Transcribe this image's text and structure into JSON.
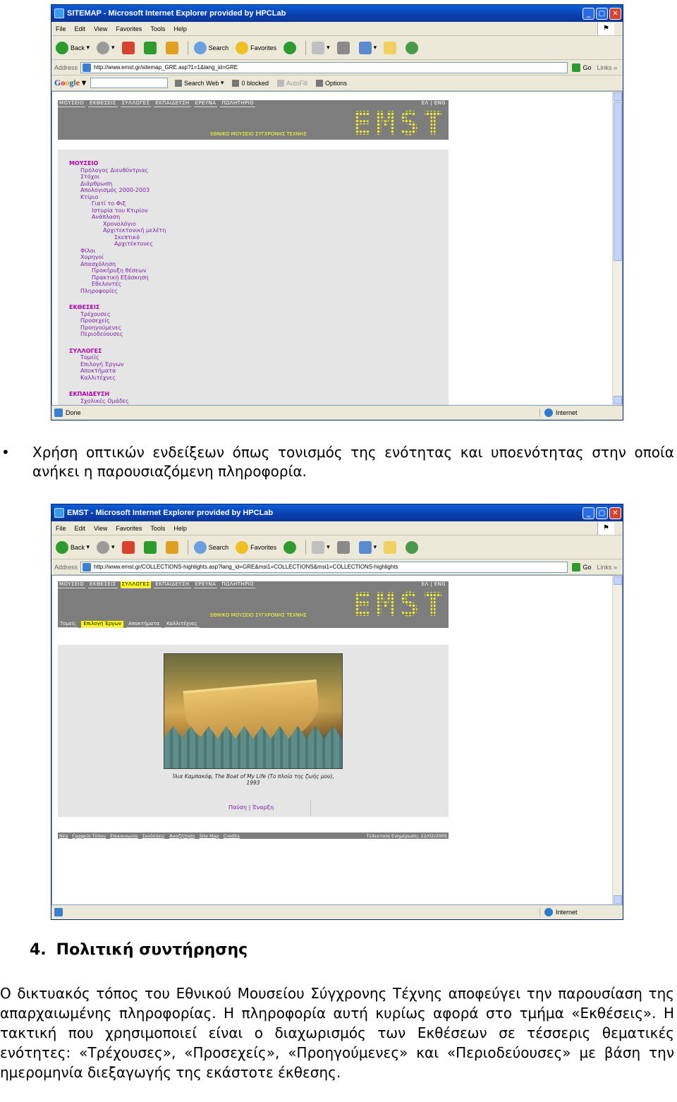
{
  "screenshot1": {
    "window_title": "SITEMAP - Microsoft Internet Explorer provided by HPCLab",
    "menu": [
      "File",
      "Edit",
      "View",
      "Favorites",
      "Tools",
      "Help"
    ],
    "toolbar": {
      "back": "Back",
      "search": "Search",
      "favorites": "Favorites"
    },
    "address_label": "Address",
    "address_url": "http://www.emst.gr/sitemap_GRE.asp?1=1&lang_id=GRE",
    "go": "Go",
    "links": "Links",
    "google": {
      "logo": [
        "G",
        "o",
        "o",
        "g",
        "l",
        "e"
      ],
      "search_web": "Search Web",
      "blocked": "0 blocked",
      "autofill": "AutoFill",
      "options": "Options"
    },
    "site_nav": [
      "ΜΟΥΣΕΙΟ",
      "ΕΚΘΕΣΕΙΣ",
      "ΣΥΛΛΟΓΕΣ",
      "ΕΚΠΑΙΔΕΥΣΗ",
      "ΕΡΕΥΝΑ",
      "ΠΩΛΗΤΗΡΙΟ"
    ],
    "lang": "ΕΛ | ENG",
    "museum_name": "ΕΘΝΙΚΟ ΜΟΥΣΕΙΟ ΣΥΓΧΡΟΝΗΣ ΤΕΧΝΗΣ",
    "logo": "EMST",
    "sitemap": [
      {
        "text": "ΜΟΥΣΕΙΟ",
        "level": 0
      },
      {
        "text": "Πρόλογος Διευθύντριας",
        "level": 1
      },
      {
        "text": "Στόχοι",
        "level": 1
      },
      {
        "text": "Διάρθρωση",
        "level": 1
      },
      {
        "text": "Απολογισμός 2000-2003",
        "level": 1
      },
      {
        "text": "Κτίριο",
        "level": 1
      },
      {
        "text": "Γιατί το Φιξ",
        "level": 2
      },
      {
        "text": "Ιστορία του Κτιρίου",
        "level": 2
      },
      {
        "text": "Ανάπλαση",
        "level": 2
      },
      {
        "text": "Χρονολόγιο",
        "level": 3
      },
      {
        "text": "Αρχιτεκτονική μελέτη",
        "level": 3
      },
      {
        "text": "Σκεπτικό",
        "level": 4
      },
      {
        "text": "Αρχιτέκτονες",
        "level": 4
      },
      {
        "text": "Φίλοι",
        "level": 1
      },
      {
        "text": "Χορηγοί",
        "level": 1
      },
      {
        "text": "Απασχόληση",
        "level": 1
      },
      {
        "text": "Προκήρυξη θέσεων",
        "level": 2
      },
      {
        "text": "Πρακτική Εξάσκηση",
        "level": 2
      },
      {
        "text": "Εθελοντές",
        "level": 2
      },
      {
        "text": "Πληροφορίες",
        "level": 1
      },
      {
        "text": "",
        "level": -1
      },
      {
        "text": "ΕΚΘΕΣΕΙΣ",
        "level": 0
      },
      {
        "text": "Τρέχουσες",
        "level": 1
      },
      {
        "text": "Προσεχείς",
        "level": 1
      },
      {
        "text": "Προηγούμενες",
        "level": 1
      },
      {
        "text": "Περιοδεύουσες",
        "level": 1
      },
      {
        "text": "",
        "level": -1
      },
      {
        "text": "ΣΥΛΛΟΓΕΣ",
        "level": 0
      },
      {
        "text": "Τομείς",
        "level": 1
      },
      {
        "text": "Επιλογή Έργων",
        "level": 1
      },
      {
        "text": "Αποκτήματα",
        "level": 1
      },
      {
        "text": "Καλλιτέχνες",
        "level": 1
      },
      {
        "text": "",
        "level": -1
      },
      {
        "text": "ΕΚΠΑΙΔΕΥΣΗ",
        "level": 0
      },
      {
        "text": "Σχολικές Ομάδες",
        "level": 1
      }
    ],
    "status_left": "Done",
    "status_zone": "Internet"
  },
  "bullet_text": "Χρήση οπτικών ενδείξεων όπως τονισμός της ενότητας και υποενότητας στην οποία ανήκει η παρουσιαζόμενη πληροφορία.",
  "screenshot2": {
    "window_title": "EMST - Microsoft Internet Explorer provided by HPCLab",
    "address_url": "http://www.emst.gr/COLLECTIONS-highlights.asp?lang_id=GRE&msi1=COLLECTIONS&msi1=COLLECTIONS-highlights",
    "active_nav": "ΣΥΛΛΟΓΕΣ",
    "sub_nav": [
      "Τομείς",
      "Επιλογή Έργων",
      "Αποκτήματα",
      "Καλλιτέχνες"
    ],
    "active_sub": "Επιλογή Έργων",
    "caption": "Ίλια Καμπακόφ, The Boat of My Life (Το πλοίο της ζωής μου), 1993",
    "controls": "Παύση | Έναρξη",
    "footer_links": [
      "Νέα",
      "Γραφείο Τύπου",
      "Επικοινωνία",
      "Συνδέσεις",
      "Αναζήτηση",
      "Site Map",
      "Credits"
    ],
    "last_update": "Τελευταία Ενημέρωση: 22/02/2005",
    "status_zone": "Internet"
  },
  "section": {
    "number": "4.",
    "title": "Πολιτική συντήρησης"
  },
  "paragraph": "Ο δικτυακός τόπος του Εθνικού Μουσείου Σύγχρονης Τέχνης αποφεύγει την παρουσίαση της απαρχαιωμένης πληροφορίας. Η πληροφορία αυτή κυρίως αφορά στο τμήμα «Εκθέσεις». Η τακτική που χρησιμοποιεί είναι ο διαχωρισμός των Εκθέσεων σε τέσσερις θεματικές ενότητες: «Τρέχουσες», «Προσεχείς», «Προηγούμενες» και «Περιοδεύουσες» με βάση την ημερομηνία διεξαγωγής της εκάστοτε έκθεσης."
}
